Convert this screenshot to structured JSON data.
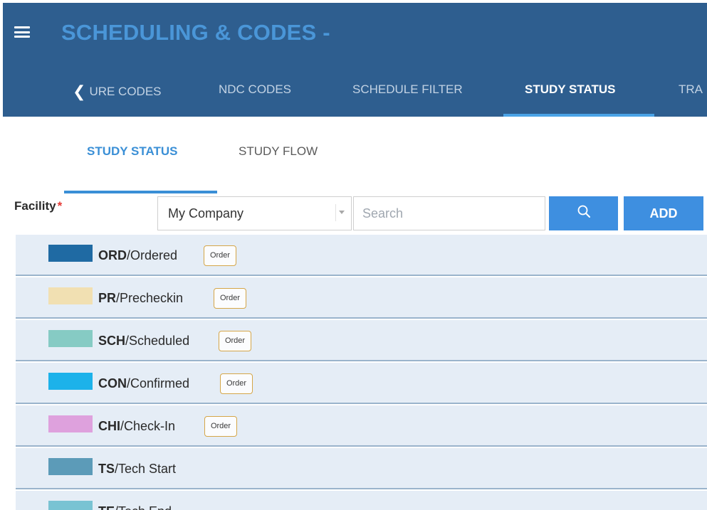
{
  "header": {
    "app_title": "SCHEDULING & CODES -",
    "menu_icon": "hamburger-menu-icon",
    "tabs": [
      {
        "label": "URE CODES",
        "icon": "chevron-left-icon"
      },
      {
        "label": "NDC CODES"
      },
      {
        "label": "SCHEDULE FILTER"
      },
      {
        "label": "STUDY STATUS",
        "active": true
      },
      {
        "label": "TRA"
      }
    ]
  },
  "subtabs": [
    {
      "label": "STUDY STATUS",
      "active": true
    },
    {
      "label": "STUDY FLOW"
    }
  ],
  "filter": {
    "facility_label": "Facility",
    "required_mark": "*",
    "facility_value": "My Company",
    "search_placeholder": "Search",
    "search_icon": "search-icon",
    "add_label": "ADD"
  },
  "statuses": [
    {
      "code": "ORD",
      "name": "/Ordered",
      "color": "#1f6aa3",
      "badge": "Order"
    },
    {
      "code": "PR",
      "name": "/Precheckin",
      "color": "#f1e0b2",
      "badge": "Order"
    },
    {
      "code": "SCH",
      "name": "/Scheduled",
      "color": "#86cbc4",
      "badge": "Order"
    },
    {
      "code": "CON",
      "name": "/Confirmed",
      "color": "#1cb2ea",
      "badge": "Order"
    },
    {
      "code": "CHI",
      "name": "/Check-In",
      "color": "#dea1dd",
      "badge": "Order"
    },
    {
      "code": "TS",
      "name": "/Tech Start",
      "color": "#5c9bb8"
    },
    {
      "code": "TE",
      "name": "/Tech End",
      "color": "#79c3d3"
    }
  ],
  "colors": {
    "header_bg": "#2e5e8f",
    "accent": "#3e8fe0",
    "row_bg": "#e5edf6"
  }
}
